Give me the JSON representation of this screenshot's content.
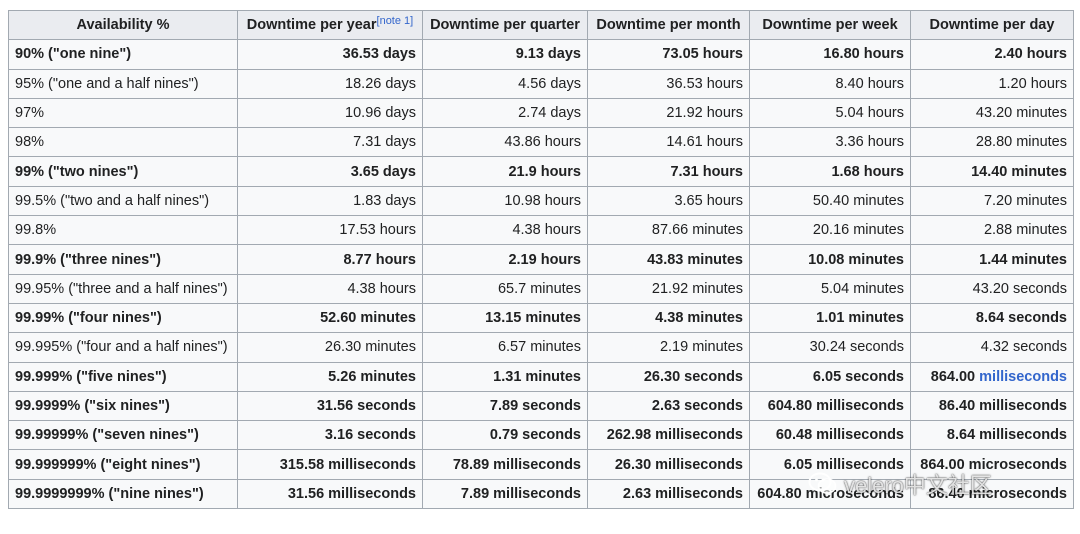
{
  "headers": [
    {
      "label": "Availability %",
      "note": ""
    },
    {
      "label": "Downtime per year",
      "note": "[note 1]"
    },
    {
      "label": "Downtime per quarter",
      "note": ""
    },
    {
      "label": "Downtime per month",
      "note": ""
    },
    {
      "label": "Downtime per week",
      "note": ""
    },
    {
      "label": "Downtime per day",
      "note": ""
    }
  ],
  "rows": [
    {
      "bold": true,
      "cells": [
        "90% (\"one nine\")",
        "36.53 days",
        "9.13 days",
        "73.05 hours",
        "16.80 hours",
        "2.40 hours"
      ]
    },
    {
      "bold": false,
      "cells": [
        "95% (\"one and a half nines\")",
        "18.26 days",
        "4.56 days",
        "36.53 hours",
        "8.40 hours",
        "1.20 hours"
      ]
    },
    {
      "bold": false,
      "cells": [
        "97%",
        "10.96 days",
        "2.74 days",
        "21.92 hours",
        "5.04 hours",
        "43.20 minutes"
      ]
    },
    {
      "bold": false,
      "cells": [
        "98%",
        "7.31 days",
        "43.86 hours",
        "14.61 hours",
        "3.36 hours",
        "28.80 minutes"
      ]
    },
    {
      "bold": true,
      "cells": [
        "99% (\"two nines\")",
        "3.65 days",
        "21.9 hours",
        "7.31 hours",
        "1.68 hours",
        "14.40 minutes"
      ]
    },
    {
      "bold": false,
      "cells": [
        "99.5% (\"two and a half nines\")",
        "1.83 days",
        "10.98 hours",
        "3.65 hours",
        "50.40 minutes",
        "7.20 minutes"
      ]
    },
    {
      "bold": false,
      "cells": [
        "99.8%",
        "17.53 hours",
        "4.38 hours",
        "87.66 minutes",
        "20.16 minutes",
        "2.88 minutes"
      ]
    },
    {
      "bold": true,
      "cells": [
        "99.9% (\"three nines\")",
        "8.77 hours",
        "2.19 hours",
        "43.83 minutes",
        "10.08 minutes",
        "1.44 minutes"
      ]
    },
    {
      "bold": false,
      "cells": [
        "99.95% (\"three and a half nines\")",
        "4.38 hours",
        "65.7 minutes",
        "21.92 minutes",
        "5.04 minutes",
        "43.20 seconds"
      ]
    },
    {
      "bold": true,
      "cells": [
        "99.99% (\"four nines\")",
        "52.60 minutes",
        "13.15 minutes",
        "4.38 minutes",
        "1.01 minutes",
        "8.64 seconds"
      ]
    },
    {
      "bold": false,
      "cells": [
        "99.995% (\"four and a half nines\")",
        "26.30 minutes",
        "6.57 minutes",
        "2.19 minutes",
        "30.24 seconds",
        "4.32 seconds"
      ]
    },
    {
      "bold": true,
      "cells": [
        "99.999% (\"five nines\")",
        "5.26 minutes",
        "1.31 minutes",
        "26.30 seconds",
        "6.05 seconds",
        "864.00 milliseconds"
      ]
    },
    {
      "bold": true,
      "cells": [
        "99.9999% (\"six nines\")",
        "31.56 seconds",
        "7.89 seconds",
        "2.63 seconds",
        "604.80 milliseconds",
        "86.40 milliseconds"
      ]
    },
    {
      "bold": true,
      "cells": [
        "99.99999% (\"seven nines\")",
        "3.16 seconds",
        "0.79 seconds",
        "262.98 milliseconds",
        "60.48 milliseconds",
        "8.64 milliseconds"
      ]
    },
    {
      "bold": true,
      "cells": [
        "99.999999% (\"eight nines\")",
        "315.58 milliseconds",
        "78.89 milliseconds",
        "26.30 milliseconds",
        "6.05 milliseconds",
        "864.00 microseconds"
      ]
    },
    {
      "bold": true,
      "cells": [
        "99.9999999% (\"nine nines\")",
        "31.56 milliseconds",
        "7.89 milliseconds",
        "2.63 milliseconds",
        "604.80 microseconds",
        "86.40 microseconds"
      ]
    }
  ],
  "links": {
    "r11_c5_number": "864.00 ",
    "r11_c5_link": "milliseconds"
  },
  "watermark": {
    "text": "velero中文社区",
    "icon": "wechat-icon"
  },
  "colors": {
    "header_bg": "#eaecf0",
    "cell_bg": "#f8f9fa",
    "border": "#a2a9b1",
    "link": "#3366cc"
  }
}
